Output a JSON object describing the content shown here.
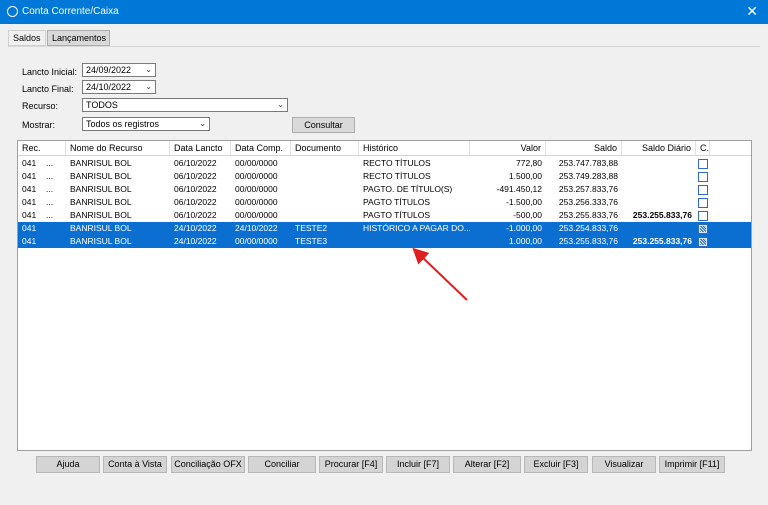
{
  "window": {
    "title": "Conta Corrente/Caixa",
    "close_icon": "close-icon"
  },
  "tabs": [
    {
      "label": "Saldos",
      "active": false
    },
    {
      "label": "Lançamentos",
      "active": true
    }
  ],
  "filters": {
    "lancto_inicial_label": "Lancto Inicial:",
    "lancto_inicial_value": "24/09/2022",
    "lancto_final_label": "Lancto Final:",
    "lancto_final_value": "24/10/2022",
    "recurso_label": "Recurso:",
    "recurso_value": "TODOS",
    "mostrar_label": "Mostrar:",
    "mostrar_value": "Todos os registros",
    "consultar_label": "Consultar"
  },
  "grid": {
    "columns": [
      "Rec.",
      "Nome do Recurso",
      "Data Lancto",
      "Data Comp.",
      "Documento",
      "Histórico",
      "Valor",
      "Saldo",
      "Saldo Diário",
      "C."
    ],
    "rows": [
      {
        "rec": "041",
        "dots": "...",
        "nome": "BANRISUL BOL",
        "data_lancto": "06/10/2022",
        "data_comp": "00/00/0000",
        "documento": "",
        "historico": "RECTO TÍTULOS",
        "valor": "772,80",
        "saldo": "253.747.783,88",
        "saldo_diario": "",
        "checked": false,
        "selected": false
      },
      {
        "rec": "041",
        "dots": "...",
        "nome": "BANRISUL BOL",
        "data_lancto": "06/10/2022",
        "data_comp": "00/00/0000",
        "documento": "",
        "historico": "RECTO TÍTULOS",
        "valor": "1.500,00",
        "saldo": "253.749.283,88",
        "saldo_diario": "",
        "checked": false,
        "selected": false
      },
      {
        "rec": "041",
        "dots": "...",
        "nome": "BANRISUL BOL",
        "data_lancto": "06/10/2022",
        "data_comp": "00/00/0000",
        "documento": "",
        "historico": "PAGTO. DE TÍTULO(S)",
        "valor": "-491.450,12",
        "saldo": "253.257.833,76",
        "saldo_diario": "",
        "checked": false,
        "selected": false
      },
      {
        "rec": "041",
        "dots": "...",
        "nome": "BANRISUL BOL",
        "data_lancto": "06/10/2022",
        "data_comp": "00/00/0000",
        "documento": "",
        "historico": "PAGTO TÍTULOS",
        "valor": "-1.500,00",
        "saldo": "253.256.333,76",
        "saldo_diario": "",
        "checked": false,
        "selected": false
      },
      {
        "rec": "041",
        "dots": "...",
        "nome": "BANRISUL BOL",
        "data_lancto": "06/10/2022",
        "data_comp": "00/00/0000",
        "documento": "",
        "historico": "PAGTO TÍTULOS",
        "valor": "-500,00",
        "saldo": "253.255.833,76",
        "saldo_diario": "253.255.833,76",
        "checked": false,
        "selected": false
      },
      {
        "rec": "041",
        "dots": "",
        "nome": "BANRISUL BOL",
        "data_lancto": "24/10/2022",
        "data_comp": "24/10/2022",
        "documento": "TESTE2",
        "historico": "HISTÓRICO A PAGAR DO...",
        "valor": "-1.000,00",
        "saldo": "253.254.833,76",
        "saldo_diario": "",
        "checked": true,
        "selected": true
      },
      {
        "rec": "041",
        "dots": "",
        "nome": "BANRISUL BOL",
        "data_lancto": "24/10/2022",
        "data_comp": "00/00/0000",
        "documento": "TESTE3",
        "historico": "",
        "valor": "1.000,00",
        "saldo": "253.255.833,76",
        "saldo_diario": "253.255.833,76",
        "checked": true,
        "selected": true
      }
    ]
  },
  "footer": {
    "buttons": [
      "Ajuda",
      "Conta à Vista",
      "Conciliação OFX",
      "Conciliar",
      "Procurar [F4]",
      "Incluir [F7]",
      "Alterar [F2]",
      "Excluir [F3]",
      "Visualizar",
      "Imprimir [F11]"
    ]
  },
  "annotation": {
    "arrow_color": "#e02020"
  }
}
